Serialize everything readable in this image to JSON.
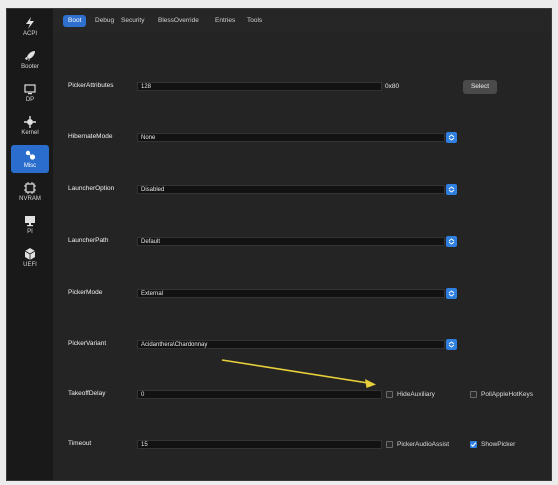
{
  "sidebar": {
    "items": [
      {
        "label": "ACPI",
        "icon": "lightning-icon",
        "active": false
      },
      {
        "label": "Booter",
        "icon": "rocket-icon",
        "active": false
      },
      {
        "label": "DP",
        "icon": "display-icon",
        "active": false
      },
      {
        "label": "Kernel",
        "icon": "kernel-icon",
        "active": false
      },
      {
        "label": "Misc",
        "icon": "misc-icon",
        "active": true
      },
      {
        "label": "NVRAM",
        "icon": "nvram-icon",
        "active": false
      },
      {
        "label": "PI",
        "icon": "platform-icon",
        "active": false
      },
      {
        "label": "UEFI",
        "icon": "uefi-icon",
        "active": false
      }
    ]
  },
  "tabs": [
    "Boot",
    "Debug",
    "Security",
    "BlessOverride",
    "Entries",
    "Tools"
  ],
  "rows": {
    "picker_attributes": {
      "label": "PickerAttributes",
      "value": "128",
      "hex": "0x80",
      "button": "Select"
    },
    "hibernate_mode": {
      "label": "HibernateMode",
      "value": "None"
    },
    "launcher_option": {
      "label": "LauncherOption",
      "value": "Disabled"
    },
    "launcher_path": {
      "label": "LauncherPath",
      "value": "Default"
    },
    "picker_mode": {
      "label": "PickerMode",
      "value": "External"
    },
    "picker_variant": {
      "label": "PickerVariant",
      "value": "Acidanthera\\Chardonnay"
    },
    "takeoff_delay": {
      "label": "TakeoffDelay",
      "value": "0"
    },
    "timeout": {
      "label": "Timeout",
      "value": "15"
    }
  },
  "checkboxes": {
    "hide_auxiliary": {
      "label": "HideAuxiliary",
      "checked": false
    },
    "poll_apple_hot_keys": {
      "label": "PollAppleHotKeys",
      "checked": false
    },
    "picker_audio_assist": {
      "label": "PickerAudioAssist",
      "checked": false
    },
    "show_picker": {
      "label": "ShowPicker",
      "checked": true
    }
  },
  "colors": {
    "accent": "#2f7fe0",
    "annotation_arrow": "#e6cf3a"
  }
}
